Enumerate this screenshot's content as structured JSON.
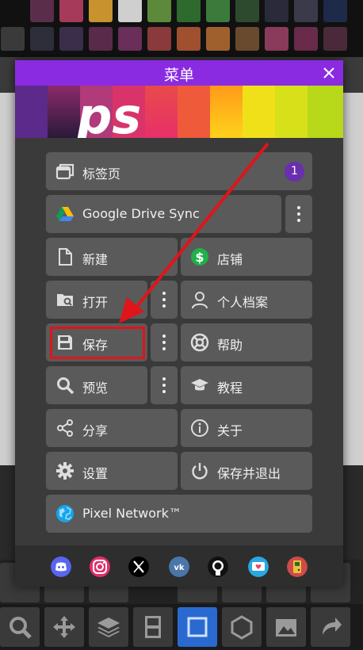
{
  "dialog": {
    "title": "菜单",
    "banner_logo_text": "ps"
  },
  "menu": {
    "tabs": {
      "label": "标签页",
      "badge": "1"
    },
    "google_drive_sync": "Google Drive Sync",
    "new": "新建",
    "store": "店铺",
    "open": "打开",
    "profile": "个人档案",
    "save": "保存",
    "help": "帮助",
    "preview": "预览",
    "tutorial": "教程",
    "share": "分享",
    "about": "关于",
    "settings": "设置",
    "save_and_exit": "保存并退出",
    "pixel_network": "Pixel Network™"
  },
  "social_icons": [
    "discord-icon",
    "instagram-icon",
    "x-icon",
    "vk-icon",
    "github-icon",
    "heart-chat-icon",
    "gameboy-icon"
  ],
  "colors": {
    "title_bar": "#8a2be2",
    "button": "#5a5a5a",
    "dialog": "#3a3a3a",
    "highlight": "#e0141b",
    "badge": "#6a2fae"
  }
}
